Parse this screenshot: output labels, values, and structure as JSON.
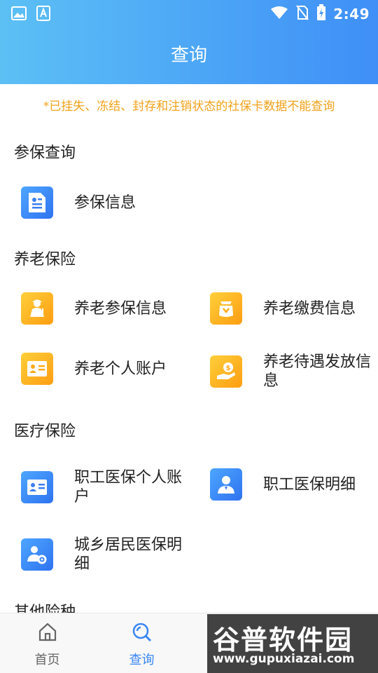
{
  "status_bar": {
    "time": "2:49"
  },
  "header": {
    "title": "查询"
  },
  "notice": "*已挂失、冻结、封存和注销状态的社保卡数据不能查询",
  "sections": {
    "insured": {
      "title": "参保查询",
      "items": [
        {
          "label": "参保信息",
          "icon": "id-card-icon"
        }
      ]
    },
    "pension": {
      "title": "养老保险",
      "items": [
        {
          "label": "养老参保信息",
          "icon": "elderly-person-icon"
        },
        {
          "label": "养老缴费信息",
          "icon": "payment-bag-icon"
        },
        {
          "label": "养老个人账户",
          "icon": "account-card-icon"
        },
        {
          "label": "养老待遇发放信息",
          "icon": "hand-money-icon"
        }
      ]
    },
    "medical": {
      "title": "医疗保险",
      "items": [
        {
          "label": "职工医保个人账户",
          "icon": "account-card-icon"
        },
        {
          "label": "职工医保明细",
          "icon": "doctor-icon"
        },
        {
          "label": "城乡居民医保明细",
          "icon": "people-gear-icon"
        }
      ]
    },
    "other": {
      "title": "其他险种"
    }
  },
  "tabs": [
    {
      "label": "首页",
      "icon": "home-icon"
    },
    {
      "label": "查询",
      "icon": "search-icon",
      "active": true
    },
    {
      "label": "",
      "icon": ""
    },
    {
      "label": "",
      "icon": ""
    }
  ],
  "watermark": {
    "text": "谷普软件园",
    "url": "www.gupuxiazai.com"
  },
  "colors": {
    "header_start": "#5cc0f5",
    "header_end": "#3f8ff7",
    "notice": "#f0a21a",
    "active_tab": "#3a86f5",
    "icon_blue": "#3a86f5",
    "icon_orange": "#ffab1a"
  }
}
